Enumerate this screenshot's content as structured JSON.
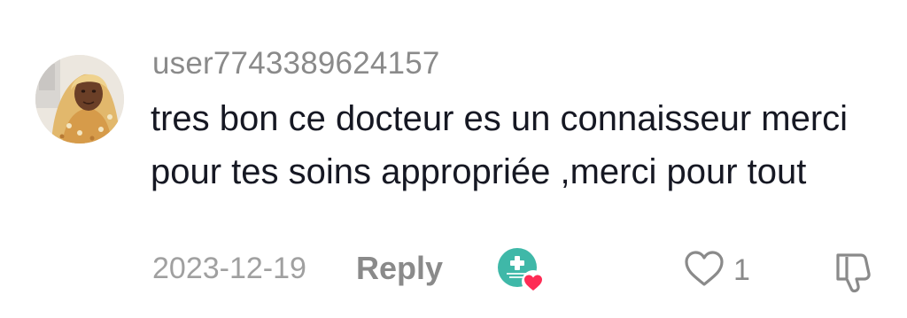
{
  "comment": {
    "username": "user7743389624157",
    "text": "tres bon ce docteur es un connaisseur merci pour tes soins appropriée ,merci pour tout",
    "date": "2023-12-19",
    "reply_label": "Reply",
    "like_count": "1"
  },
  "icons": {
    "avatar": "user-avatar",
    "creator_like": "creator-liked-badge-icon",
    "like": "heart-outline-icon",
    "dislike": "thumbs-down-icon"
  },
  "colors": {
    "username": "#8a8a8a",
    "text": "#161823",
    "meta": "#a0a0a0",
    "heart_badge": "#fe2c55",
    "creator_badge_bg": "#3fb8a8"
  }
}
